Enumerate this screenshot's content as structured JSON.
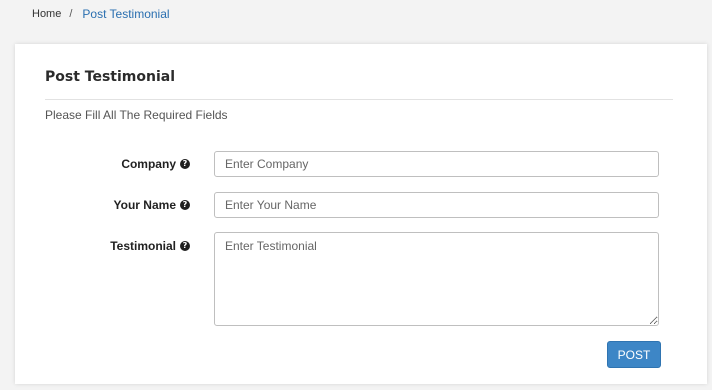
{
  "breadcrumb": {
    "home": "Home",
    "separator": "/",
    "current": "Post Testimonial"
  },
  "card": {
    "title": "Post Testimonial",
    "subtitle": "Please Fill All The Required Fields"
  },
  "form": {
    "company": {
      "label": "Company",
      "placeholder": "Enter Company",
      "value": ""
    },
    "your_name": {
      "label": "Your Name",
      "placeholder": "Enter Your Name",
      "value": ""
    },
    "testimonial": {
      "label": "Testimonial",
      "placeholder": "Enter Testimonial",
      "value": ""
    },
    "help_glyph": "?",
    "submit_label": "POST"
  },
  "icons": {
    "help": "question-circle-icon"
  },
  "colors": {
    "accent": "#3d86c6",
    "link": "#2a6fb0"
  }
}
